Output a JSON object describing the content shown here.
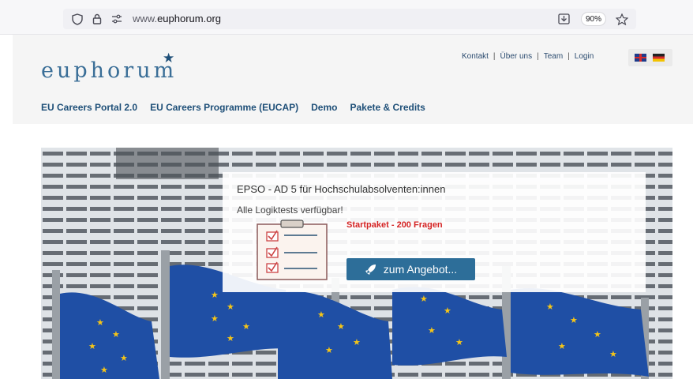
{
  "browser": {
    "url_prefix": "www.",
    "url_domain": "euphorum.org",
    "zoom": "90%"
  },
  "header": {
    "logo": "euphorum",
    "top_links": [
      "Kontakt",
      "Über uns",
      "Team",
      "Login"
    ],
    "nav": [
      "EU Careers Portal 2.0",
      "EU Careers Programme (EUCAP)",
      "Demo",
      "Pakete & Credits"
    ]
  },
  "hero": {
    "title": "EPSO - AD 5 für Hochschulabsolventen:innen",
    "subtitle": "Alle Logiktests verfügbar!",
    "highlight": "Startpaket - 200 Fragen",
    "button": "zum Angebot..."
  },
  "colors": {
    "brand_blue": "#2d6e99",
    "highlight_red": "#d42323",
    "eu_blue": "#1f4fa5",
    "eu_gold": "#f5c518"
  }
}
